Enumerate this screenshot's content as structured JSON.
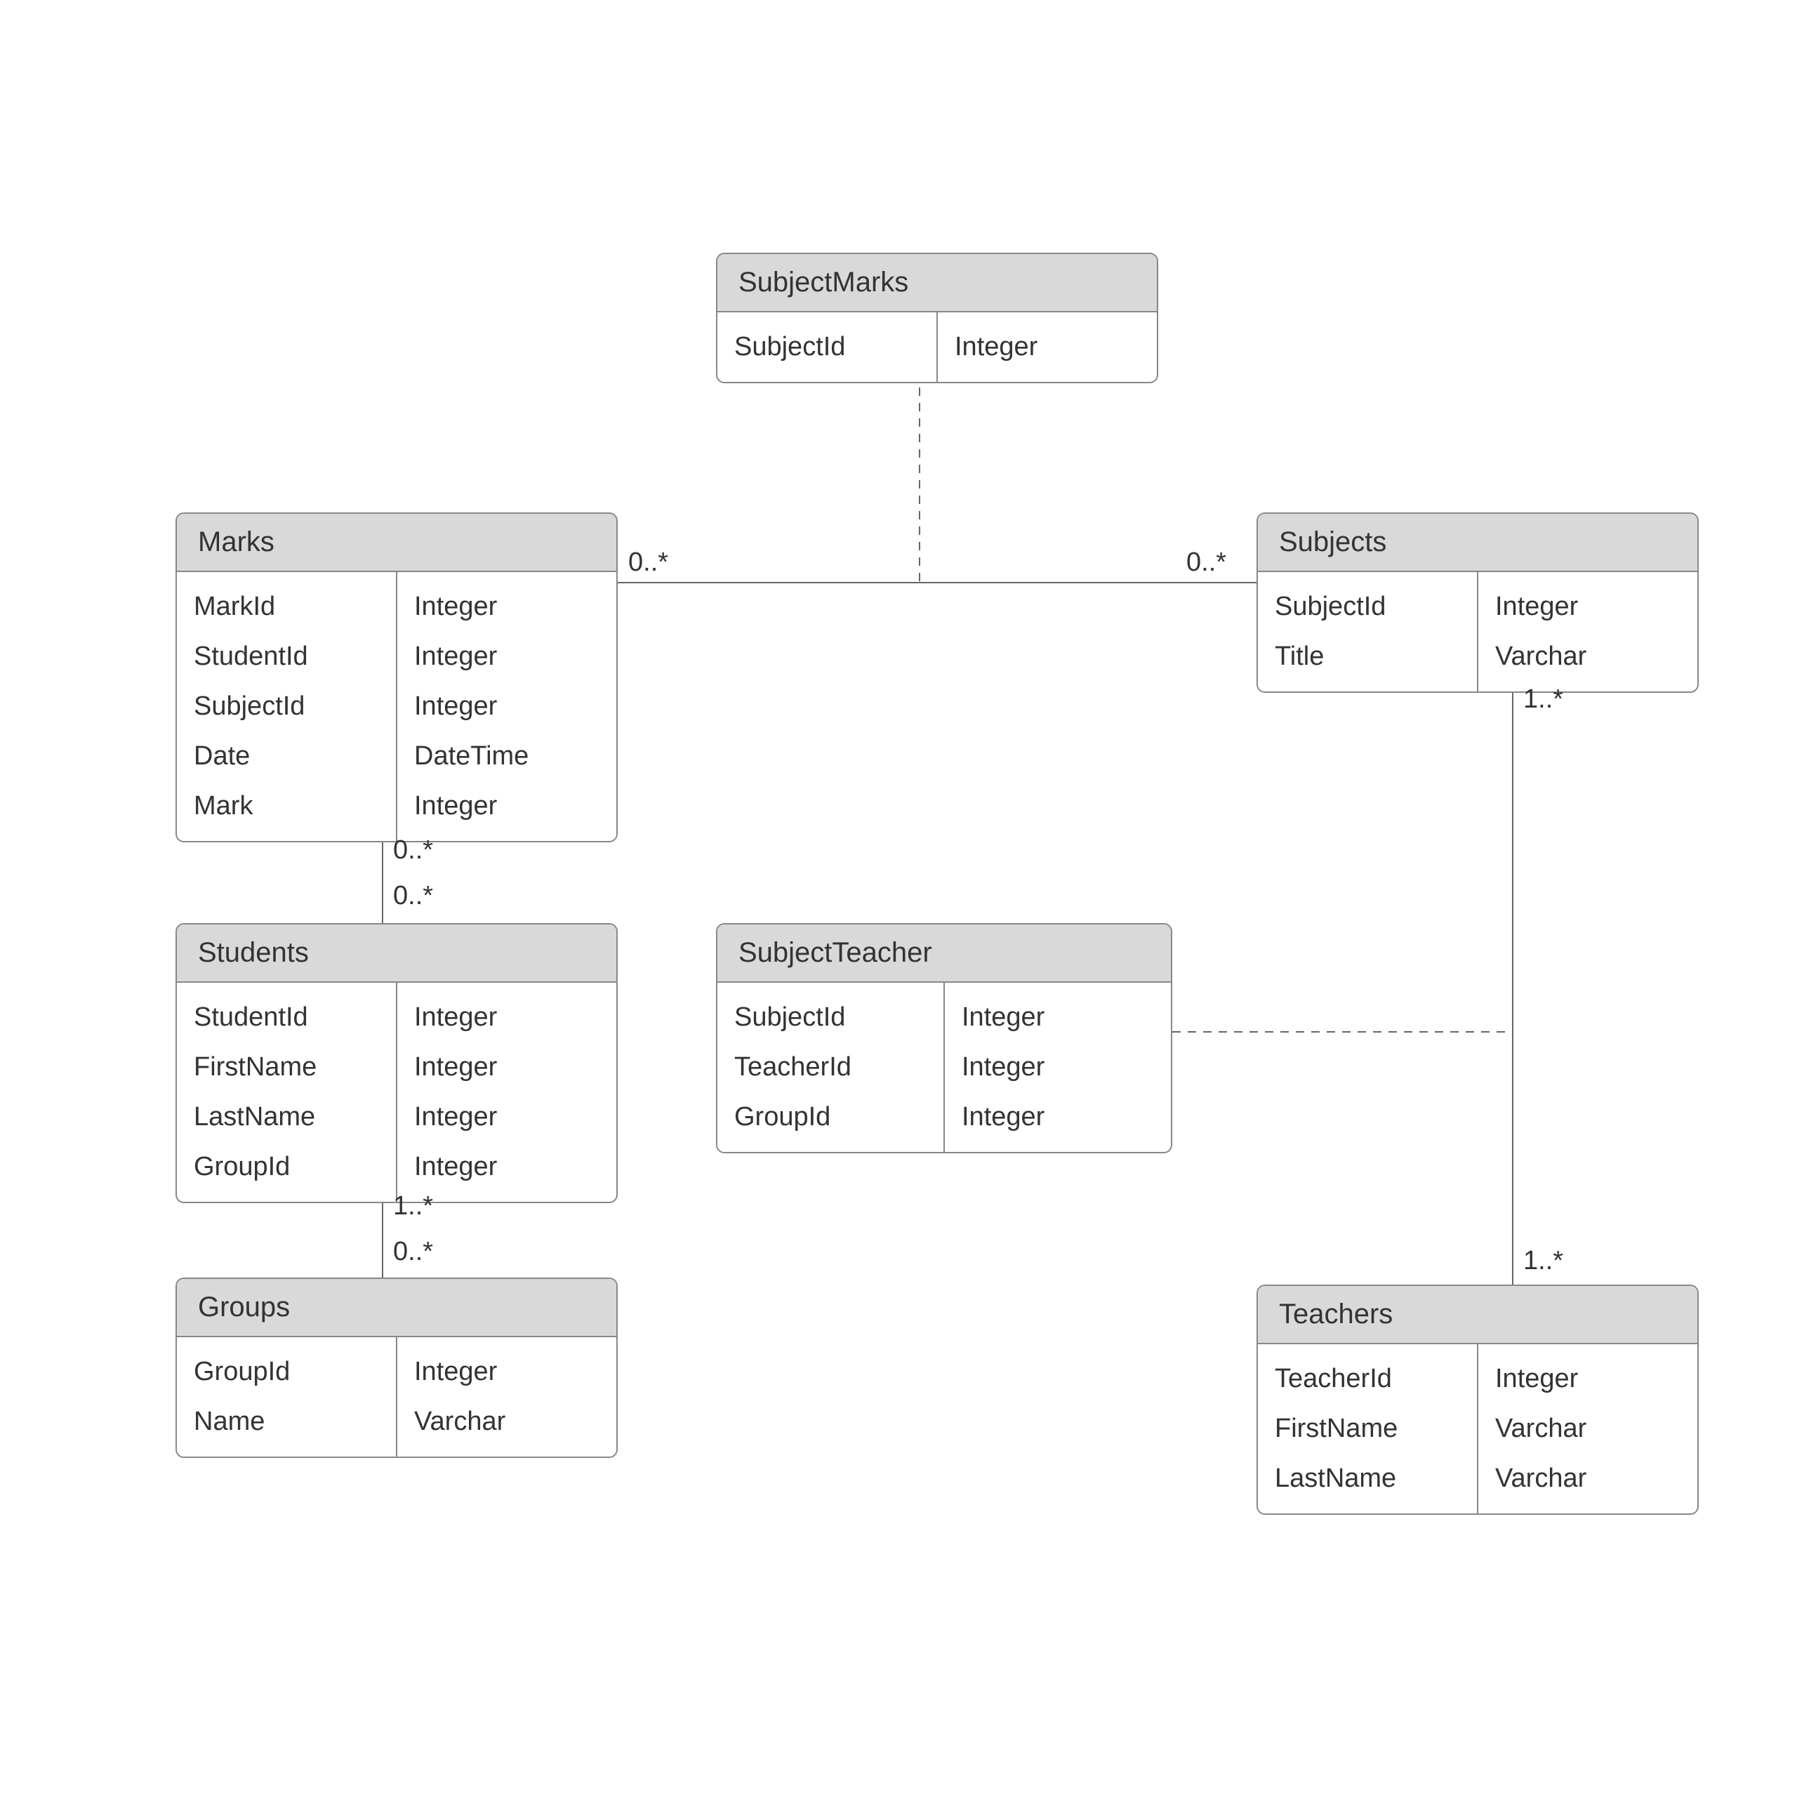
{
  "entities": {
    "subjectMarks": {
      "name": "SubjectMarks",
      "fields": [
        {
          "name": "SubjectId",
          "type": "Integer"
        }
      ]
    },
    "marks": {
      "name": "Marks",
      "fields": [
        {
          "name": "MarkId",
          "type": "Integer"
        },
        {
          "name": "StudentId",
          "type": "Integer"
        },
        {
          "name": "SubjectId",
          "type": "Integer"
        },
        {
          "name": "Date",
          "type": "DateTime"
        },
        {
          "name": "Mark",
          "type": "Integer"
        }
      ]
    },
    "subjects": {
      "name": "Subjects",
      "fields": [
        {
          "name": "SubjectId",
          "type": "Integer"
        },
        {
          "name": "Title",
          "type": "Varchar"
        }
      ]
    },
    "students": {
      "name": "Students",
      "fields": [
        {
          "name": "StudentId",
          "type": "Integer"
        },
        {
          "name": "FirstName",
          "type": "Integer"
        },
        {
          "name": "LastName",
          "type": "Integer"
        },
        {
          "name": "GroupId",
          "type": "Integer"
        }
      ]
    },
    "subjectTeacher": {
      "name": "SubjectTeacher",
      "fields": [
        {
          "name": "SubjectId",
          "type": "Integer"
        },
        {
          "name": "TeacherId",
          "type": "Integer"
        },
        {
          "name": "GroupId",
          "type": "Integer"
        }
      ]
    },
    "groups": {
      "name": "Groups",
      "fields": [
        {
          "name": "GroupId",
          "type": "Integer"
        },
        {
          "name": "Name",
          "type": "Varchar"
        }
      ]
    },
    "teachers": {
      "name": "Teachers",
      "fields": [
        {
          "name": "TeacherId",
          "type": "Integer"
        },
        {
          "name": "FirstName",
          "type": "Varchar"
        },
        {
          "name": "LastName",
          "type": "Varchar"
        }
      ]
    }
  },
  "cardinalities": {
    "marksToSubjects_left": "0..*",
    "marksToSubjects_right": "0..*",
    "marksToStudents_top": "0..*",
    "marksToStudents_bottom": "0..*",
    "studentsToGroups_top": "1..*",
    "studentsToGroups_bottom": "0..*",
    "subjectsToTeachers_top": "1..*",
    "subjectsToTeachers_bottom": "1..*"
  }
}
